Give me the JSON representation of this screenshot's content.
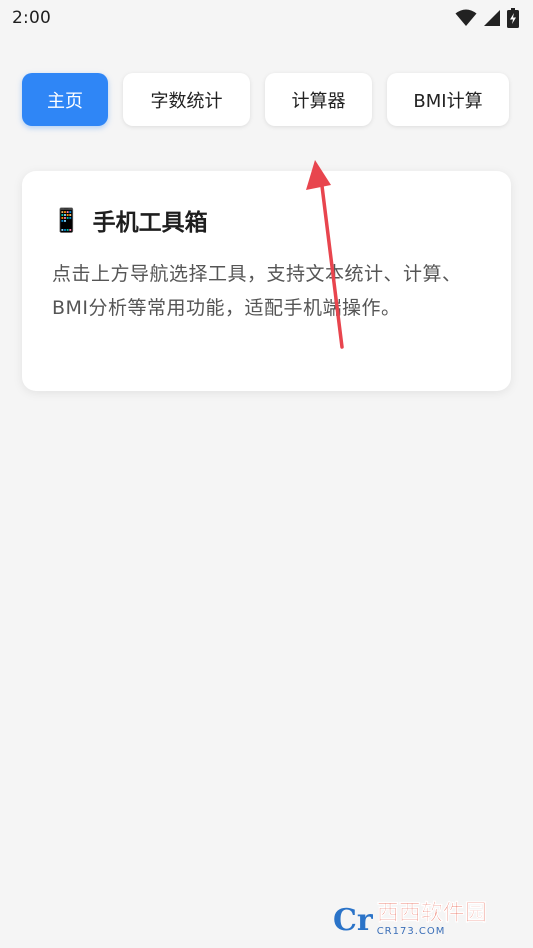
{
  "status_bar": {
    "time": "2:00"
  },
  "nav": {
    "items": [
      {
        "label": "主页",
        "active": true
      },
      {
        "label": "字数统计",
        "active": false
      },
      {
        "label": "计算器",
        "active": false
      },
      {
        "label": "BMI计算",
        "active": false
      }
    ]
  },
  "card": {
    "emoji": "📱",
    "title": "手机工具箱",
    "description": "点击上方导航选择工具，支持文本统计、计算、BMI分析等常用功能，适配手机端操作。"
  },
  "watermark": {
    "brand": "西西软件园",
    "sub": "CR173.COM"
  },
  "colors": {
    "accent": "#2f86f6",
    "arrow": "#e8454e"
  },
  "icons": [
    "wifi-icon",
    "signal-icon",
    "battery-icon",
    "phone-icon"
  ]
}
